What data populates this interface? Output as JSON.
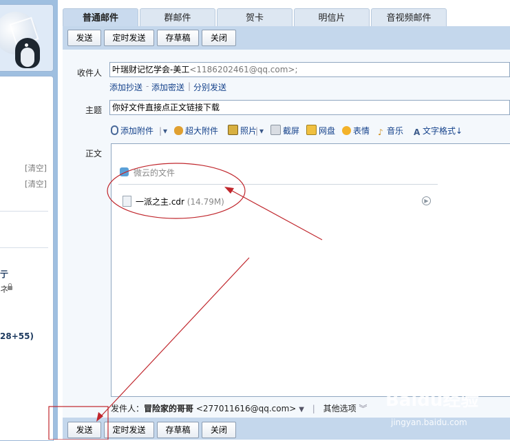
{
  "tabs": [
    "普通邮件",
    "群邮件",
    "贺卡",
    "明信片",
    "音视频邮件"
  ],
  "toolbar": {
    "send": "发送",
    "scheduled_send": "定时发送",
    "save_draft": "存草稿",
    "close": "关闭"
  },
  "compose": {
    "recipient_label": "收件人",
    "recipient_name": "叶瑞财记忆学会-美工",
    "recipient_email": "<1186202461@qq.com>;",
    "add_cc": "添加抄送",
    "dash": "-",
    "add_bcc": "添加密送",
    "pipe": "|",
    "separate_send": "分别发送",
    "subject_label": "主题",
    "subject_value": "你好文件直接点正文链接下载",
    "body_label": "正文"
  },
  "attach_toolbar": {
    "add_attachment": "添加附件",
    "large_attachment": "超大附件",
    "photo": "照片",
    "screenshot": "截屏",
    "netdisk": "网盘",
    "emoticon": "表情",
    "music": "音乐",
    "text_format": "文字格式↓",
    "pipe": "|"
  },
  "weiyun": {
    "title": "微云的文件",
    "file_name": "一派之主.cdr",
    "file_size": "(14.79M)"
  },
  "sender": {
    "label": "发件人：",
    "name": "冒险家的哥哥",
    "email": "<277011616@qq.com>",
    "pipe": "|",
    "other_options": "其他选项"
  },
  "sidebar": {
    "clear1": "[清空]",
    "clear2": "[清空]",
    "frag1": "亍",
    "frag2": "ネ",
    "frag3": "28+55)"
  },
  "watermark": {
    "main": "Baidu经验",
    "sub": "jingyan.baidu.com"
  },
  "colors": {
    "toolbar": "#c4d7ec",
    "tab_active": "#c9daee",
    "link": "#15428b",
    "annotation_red": "#c0262c"
  }
}
